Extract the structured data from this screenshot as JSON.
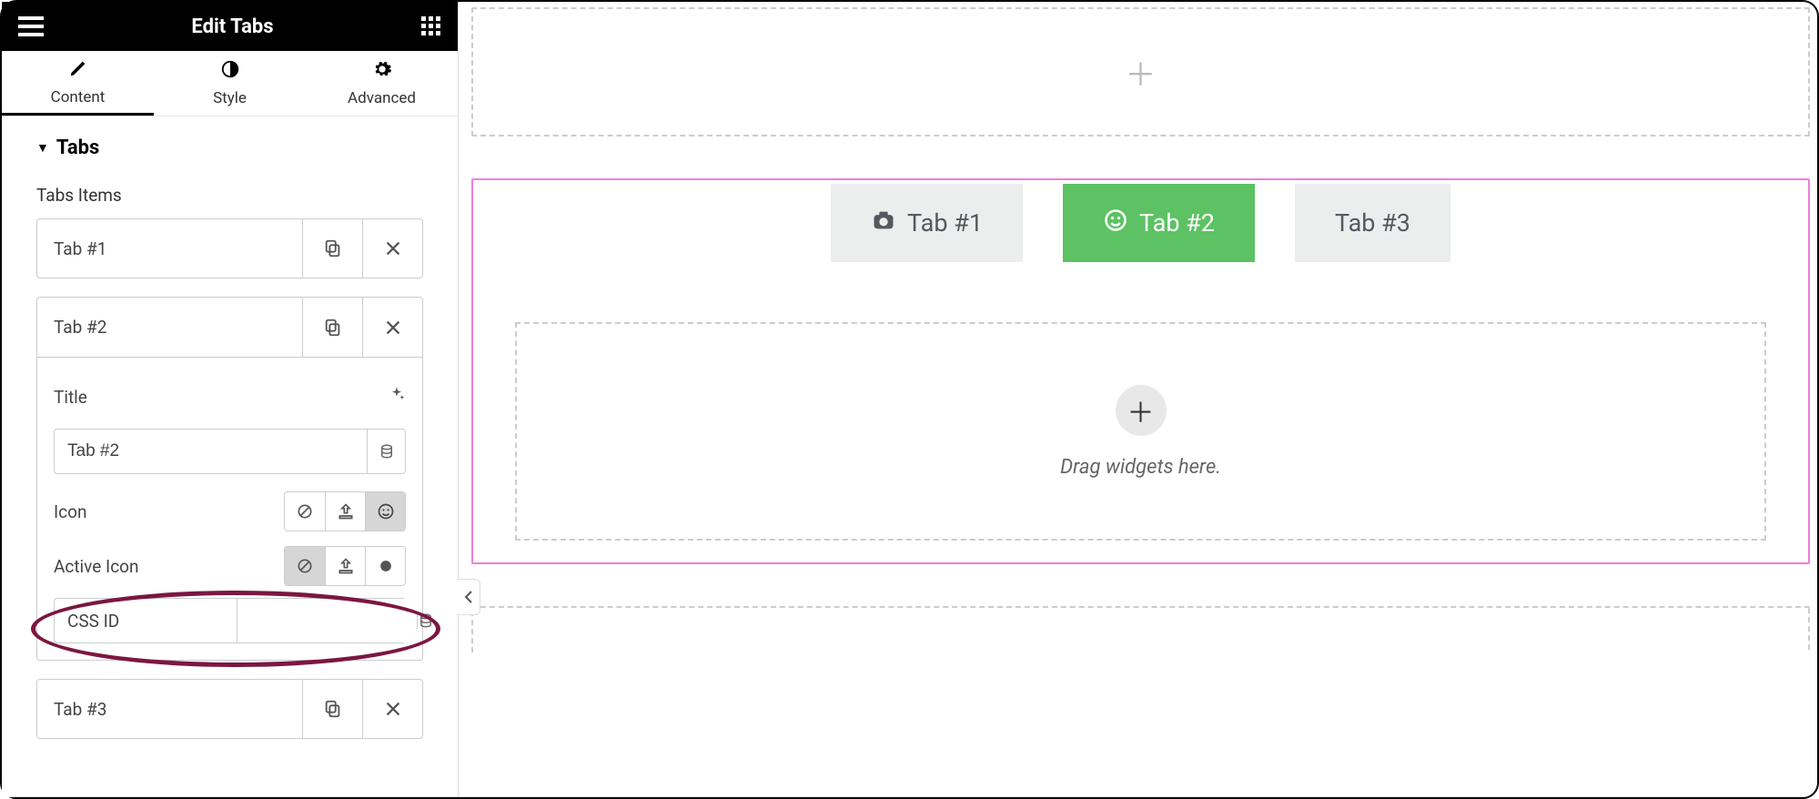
{
  "header": {
    "title": "Edit Tabs"
  },
  "panelTabs": [
    {
      "label": "Content",
      "icon": "pencil",
      "active": true
    },
    {
      "label": "Style",
      "icon": "contrast",
      "active": false
    },
    {
      "label": "Advanced",
      "icon": "gear",
      "active": false
    }
  ],
  "section": {
    "title": "Tabs",
    "itemsLabel": "Tabs Items"
  },
  "items": [
    {
      "title": "Tab #1"
    },
    {
      "title": "Tab #2"
    },
    {
      "title": "Tab #3"
    }
  ],
  "expanded": {
    "titleLabel": "Title",
    "titleValue": "Tab #2",
    "iconLabel": "Icon",
    "activeIconLabel": "Active Icon",
    "cssIdLabel": "CSS ID",
    "cssIdValue": ""
  },
  "canvas": {
    "tabs": [
      {
        "label": "Tab #1",
        "icon": "camera",
        "active": false
      },
      {
        "label": "Tab #2",
        "icon": "smile",
        "active": true
      },
      {
        "label": "Tab #3",
        "icon": "",
        "active": false
      }
    ],
    "dropHint": "Drag widgets here."
  },
  "colors": {
    "accent": "#5cc263",
    "selection": "#ee7ee0",
    "annotation": "#7b1741"
  }
}
